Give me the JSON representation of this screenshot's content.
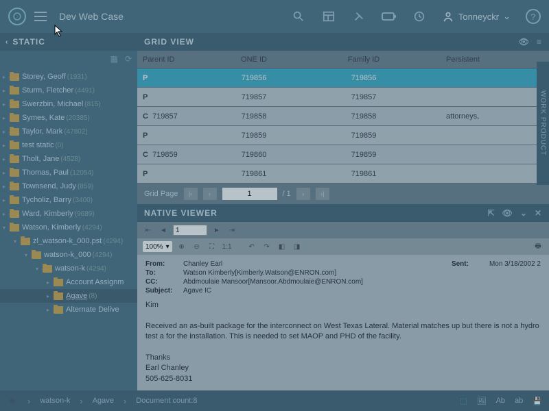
{
  "topbar": {
    "case": "Dev Web Case",
    "user": "Tonneyckr"
  },
  "sidebar": {
    "title": "STATIC",
    "items": [
      {
        "ind": 0,
        "label": "Storey, Geoff",
        "count": "(1931)"
      },
      {
        "ind": 0,
        "label": "Sturm, Fletcher",
        "count": "(4491)"
      },
      {
        "ind": 0,
        "label": "Swerzbin, Michael",
        "count": "(815)"
      },
      {
        "ind": 0,
        "label": "Symes, Kate",
        "count": "(20385)"
      },
      {
        "ind": 0,
        "label": "Taylor, Mark",
        "count": "(47802)"
      },
      {
        "ind": 0,
        "label": "test static",
        "count": "(0)"
      },
      {
        "ind": 0,
        "label": "Tholt, Jane",
        "count": "(4528)"
      },
      {
        "ind": 0,
        "label": "Thomas, Paul",
        "count": "(12054)"
      },
      {
        "ind": 0,
        "label": "Townsend, Judy",
        "count": "(859)"
      },
      {
        "ind": 0,
        "label": "Tycholiz, Barry",
        "count": "(3400)"
      },
      {
        "ind": 0,
        "label": "Ward, Kimberly",
        "count": "(9689)"
      },
      {
        "ind": 0,
        "label": "Watson, Kimberly",
        "count": "(4294)",
        "open": true
      },
      {
        "ind": 1,
        "label": "zl_watson-k_000.pst",
        "count": "(4294)",
        "open": true
      },
      {
        "ind": 2,
        "label": "watson-k_000",
        "count": "(4294)",
        "open": true
      },
      {
        "ind": 3,
        "label": "watson-k",
        "count": "(4294)",
        "open": true
      },
      {
        "ind": 4,
        "label": "Account Assignm",
        "count": ""
      },
      {
        "ind": 4,
        "label": "Agave",
        "count": "(8)",
        "sel": true
      },
      {
        "ind": 4,
        "label": "Alternate Delive",
        "count": ""
      }
    ]
  },
  "grid": {
    "title": "GRID VIEW",
    "cols": [
      "Parent ID",
      "ONE ID",
      "Family ID",
      "Persistent"
    ],
    "rows": [
      {
        "p": "P",
        "pid": "",
        "one": "719856",
        "fam": "719856",
        "per": "",
        "sel": true
      },
      {
        "p": "P",
        "pid": "",
        "one": "719857",
        "fam": "719857",
        "per": ""
      },
      {
        "p": "C",
        "pid": "719857",
        "one": "719858",
        "fam": "719858",
        "per": "attorneys,"
      },
      {
        "p": "P",
        "pid": "",
        "one": "719859",
        "fam": "719859",
        "per": ""
      },
      {
        "p": "C",
        "pid": "719859",
        "one": "719860",
        "fam": "719859",
        "per": ""
      },
      {
        "p": "P",
        "pid": "",
        "one": "719861",
        "fam": "719861",
        "per": ""
      }
    ],
    "pager": {
      "label": "Grid Page",
      "page": "1",
      "total": "/ 1"
    }
  },
  "viewer": {
    "title": "NATIVE VIEWER",
    "pagenum": "1",
    "zoom": "100%",
    "ratio": "1:1",
    "email": {
      "from_lbl": "From:",
      "from": "Chanley Earl",
      "to_lbl": "To:",
      "to": "Watson Kimberly[Kimberly.Watson@ENRON.com]",
      "cc_lbl": "CC:",
      "cc": "Abdmoulaie Mansoor[Mansoor.Abdmoulaie@ENRON.com]",
      "subj_lbl": "Subject:",
      "subj": "Agave IC",
      "sent_lbl": "Sent:",
      "sent": "Mon 3/18/2002 2",
      "greeting": "Kim",
      "body": "Received an as-built package for the interconnect on West Texas Lateral. Material matches up but there is not a hydro test a for the installation. This is needed to set MAOP and PHD of the facility.",
      "sig1": "Thanks",
      "sig2": "Earl Chanley",
      "sig3": "505-625-8031"
    }
  },
  "bottom": {
    "crumbs": [
      "watson-k",
      "Agave"
    ],
    "doccount": "Document count:8"
  },
  "sidepanel": "WORK PRODUCT"
}
